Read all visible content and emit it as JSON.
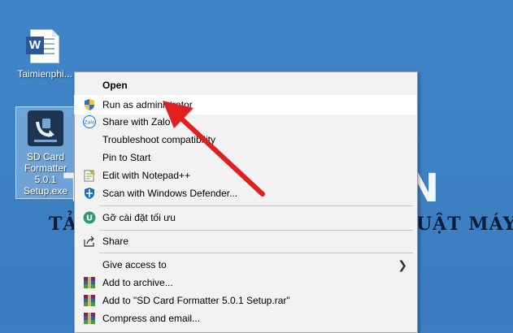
{
  "desktop": {
    "watermark": {
      "t": "T",
      "n": "N",
      "line1": "TẢ",
      "line2": "UẬT MÁY"
    },
    "icons": [
      {
        "label": "Taimienphi..."
      },
      {
        "label": "SD Card\nFormatter\n5.0.1\nSetup.exe"
      }
    ]
  },
  "menu": {
    "items": [
      {
        "label": "Open"
      },
      {
        "label": "Run as administrator"
      },
      {
        "label": "Share with Zalo"
      },
      {
        "label": "Troubleshoot compatibility"
      },
      {
        "label": "Pin to Start"
      },
      {
        "label": "Edit with Notepad++"
      },
      {
        "label": "Scan with Windows Defender..."
      },
      {
        "label": "Gỡ cài đặt tối ưu"
      },
      {
        "label": "Share"
      },
      {
        "label": "Give access to"
      },
      {
        "label": "Add to archive..."
      },
      {
        "label": "Add to \"SD Card Formatter 5.0.1 Setup.rar\""
      },
      {
        "label": "Compress and email..."
      }
    ],
    "submenu_chevron": "❯"
  },
  "icon_names": [
    "word-doc-icon",
    "sd-card-formatter-icon",
    "uac-shield-icon",
    "zalo-icon",
    "notepad-plus-plus-icon",
    "windows-defender-icon",
    "uninstall-icon",
    "share-icon",
    "winrar-icon"
  ],
  "colors": {
    "desktop": "#3f86c8",
    "arrow": "#e0201e",
    "menu_bg": "#f2f2f2"
  }
}
